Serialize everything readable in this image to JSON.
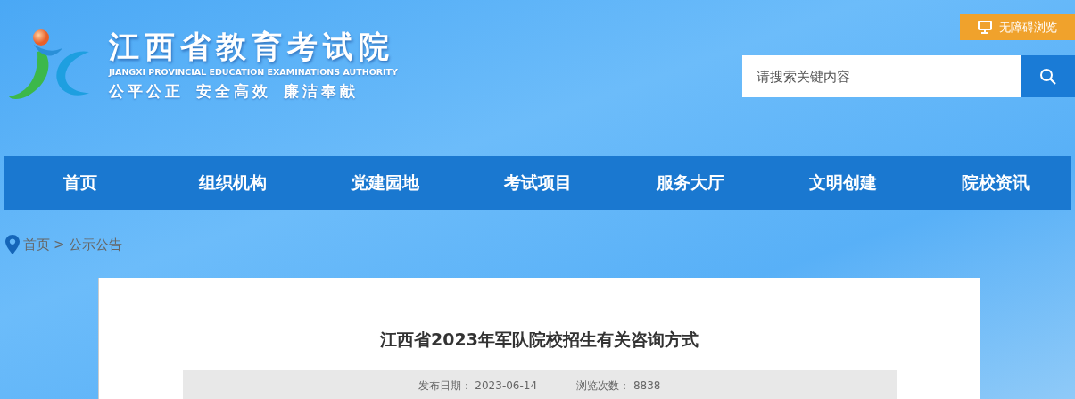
{
  "site": {
    "title": "江西省教育考试院",
    "subtitle": "JIANGXI PROVINCIAL EDUCATION EXAMINATIONS AUTHORITY",
    "slogans": [
      "公平公正",
      "安全高效",
      "廉洁奉献"
    ]
  },
  "accessibility_button": {
    "label": "无障碍浏览"
  },
  "search": {
    "placeholder": "请搜索关键内容"
  },
  "nav": [
    {
      "label": "首页"
    },
    {
      "label": "组织机构"
    },
    {
      "label": "党建园地"
    },
    {
      "label": "考试项目"
    },
    {
      "label": "服务大厅"
    },
    {
      "label": "文明创建"
    },
    {
      "label": "院校资讯"
    }
  ],
  "breadcrumb": {
    "items": [
      {
        "label": "首页"
      },
      {
        "label": "公示公告"
      }
    ],
    "separator": ">"
  },
  "article": {
    "title": "江西省2023年军队院校招生有关咨询方式",
    "meta": [
      {
        "label": "发布日期：",
        "value": "2023-06-14"
      },
      {
        "label": "浏览次数：",
        "value": "8838"
      }
    ]
  }
}
